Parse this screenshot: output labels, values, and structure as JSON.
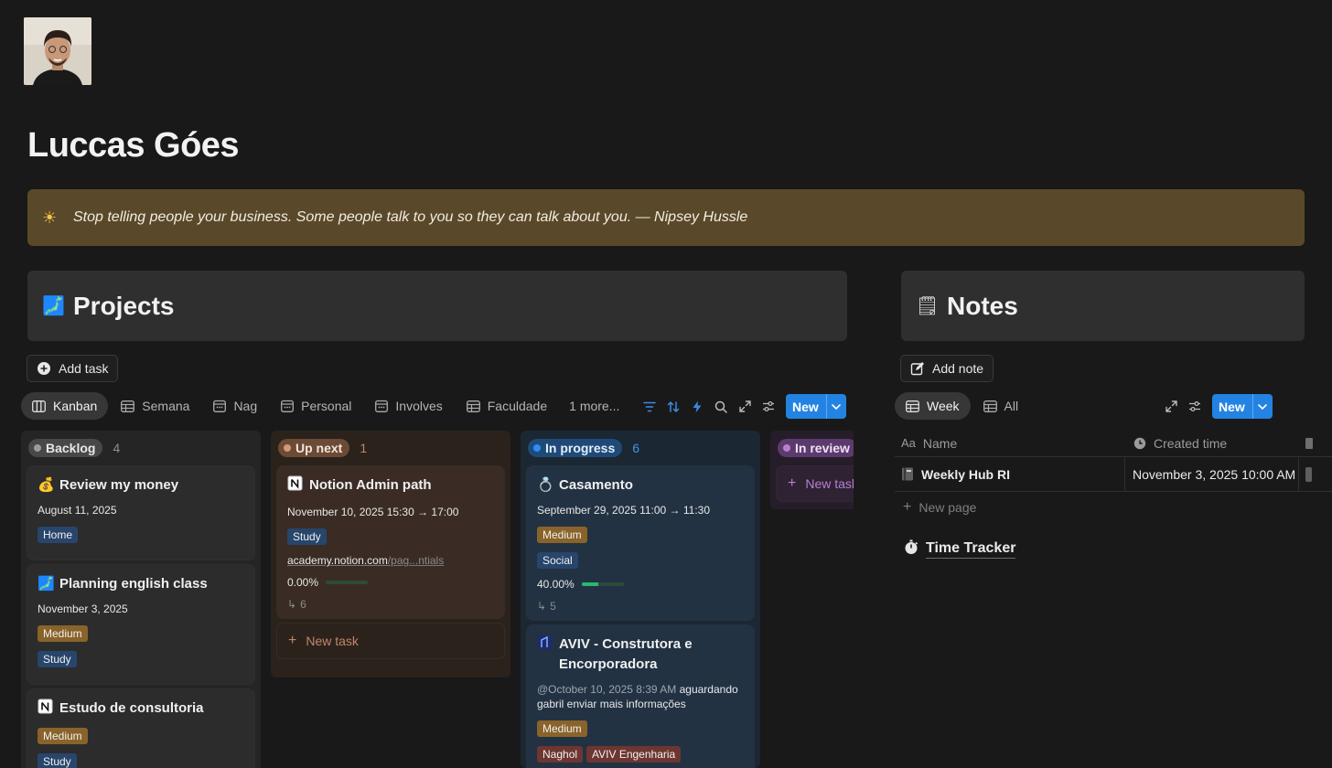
{
  "profile": {
    "name": "Luccas Góes"
  },
  "callout": {
    "icon": "sun-icon",
    "text": "Stop telling people your business. Some people talk to you so they can talk about you. — Nipsey Hussle"
  },
  "projects": {
    "title": "Projects",
    "icon": "map-icon",
    "add_label": "Add task",
    "tabs": [
      "Kanban",
      "Semana",
      "Nag",
      "Personal",
      "Involves",
      "Faculdade",
      "1 more..."
    ],
    "new_label": "New",
    "columns": [
      {
        "name": "Backlog",
        "count": "4",
        "cards": [
          {
            "emoji": "💰",
            "title": "Review my money",
            "date": "August 11, 2025",
            "tags": [
              "Home"
            ]
          },
          {
            "emoji": "🗾",
            "title": "Planning english class",
            "date": "November 3, 2025",
            "tags": [
              "Medium",
              "Study"
            ]
          },
          {
            "emoji": "N",
            "title": "Estudo de consultoria",
            "tags": [
              "Medium",
              "Study"
            ]
          }
        ]
      },
      {
        "name": "Up next",
        "count": "1",
        "cards": [
          {
            "emoji": "N",
            "title": "Notion Admin path",
            "date": "November 10, 2025 15:30 → 17:00",
            "tags": [
              "Study"
            ],
            "link_main": "academy.notion.com",
            "link_dim": "/pag...ntials",
            "progress": "0.00%",
            "progress_value": 0,
            "subtasks": "6"
          }
        ],
        "new_task": "New task"
      },
      {
        "name": "In progress",
        "count": "6",
        "cards": [
          {
            "emoji": "💍",
            "title": "Casamento",
            "date": "September 29, 2025 11:00 → 11:30",
            "tags": [
              "Medium",
              "Social"
            ],
            "progress": "40.00%",
            "progress_value": 0.4,
            "subtasks": "5"
          },
          {
            "emoji": "🏢",
            "title": "AVIV - Construtora e Encorporadora",
            "mention": "@October 10, 2025 8:39 AM",
            "note": " aguardando gabril enviar mais informações",
            "tags": [
              "Medium",
              "Naghol",
              "AVIV Engenharia"
            ]
          }
        ]
      },
      {
        "name": "In review",
        "new_task": "New task"
      }
    ]
  },
  "notes": {
    "title": "Notes",
    "icon": "notepad-icon",
    "add_label": "Add note",
    "tabs": [
      "Week",
      "All"
    ],
    "new_label": "New",
    "columns": [
      "Name",
      "Created time"
    ],
    "rows": [
      {
        "name": "Weekly Hub RI",
        "created": "November 3, 2025 10:00 AM"
      }
    ],
    "new_page": "New page",
    "time_tracker": "Time Tracker"
  },
  "colors": {
    "accent": "#2383e2",
    "callout": "#59492a",
    "backlog": "#252525",
    "up_next": "#2b221c",
    "in_progress": "#1b2733",
    "in_review": "#261d2a"
  }
}
